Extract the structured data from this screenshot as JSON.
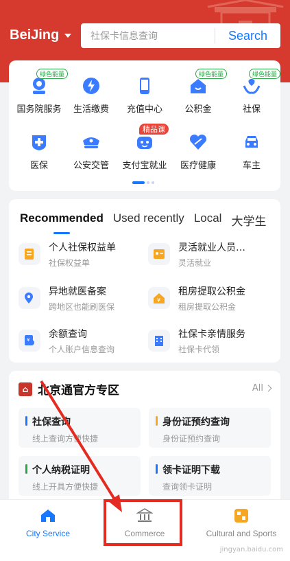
{
  "header": {
    "city": "BeiJing",
    "search_placeholder": "社保卡信息查询",
    "search_button": "Search"
  },
  "services": [
    {
      "label": "国务院服务",
      "icon": "gov-service-icon",
      "badge": "绿色能量",
      "badge_type": "green"
    },
    {
      "label": "生活缴费",
      "icon": "lightning-bill-icon",
      "badge": "",
      "badge_type": ""
    },
    {
      "label": "充值中心",
      "icon": "phone-recharge-icon",
      "badge": "",
      "badge_type": ""
    },
    {
      "label": "公积金",
      "icon": "housing-fund-icon",
      "badge": "绿色能量",
      "badge_type": "green"
    },
    {
      "label": "社保",
      "icon": "social-security-icon",
      "badge": "绿色能量",
      "badge_type": "green"
    },
    {
      "label": "医保",
      "icon": "medical-insurance-icon",
      "badge": "",
      "badge_type": ""
    },
    {
      "label": "公安交管",
      "icon": "police-cap-icon",
      "badge": "",
      "badge_type": ""
    },
    {
      "label": "支付宝就业",
      "icon": "employment-robot-icon",
      "badge": "精品课",
      "badge_type": "red"
    },
    {
      "label": "医疗健康",
      "icon": "health-heart-icon",
      "badge": "",
      "badge_type": ""
    },
    {
      "label": "车主",
      "icon": "car-icon",
      "badge": "",
      "badge_type": ""
    }
  ],
  "recommended": {
    "tabs": [
      "Recommended",
      "Used recently",
      "Local",
      "大学生"
    ],
    "active_tab": 0,
    "items": [
      {
        "title": "个人社保权益单",
        "sub": "社保权益单",
        "icon": "document-icon"
      },
      {
        "title": "灵活就业人员…",
        "sub": "灵活就业",
        "icon": "id-card-icon"
      },
      {
        "title": "异地就医备案",
        "sub": "跨地区也能刷医保",
        "icon": "location-plus-icon"
      },
      {
        "title": "租房提取公积金",
        "sub": "租房提取公积金",
        "icon": "house-yen-icon"
      },
      {
        "title": "余额查询",
        "sub": "个人账户信息查询",
        "icon": "balance-search-icon"
      },
      {
        "title": "社保卡亲情服务",
        "sub": "社保卡代领",
        "icon": "building-icon"
      }
    ]
  },
  "beijing": {
    "title": "北京通官方专区",
    "all_label": "All",
    "tiles": [
      {
        "title": "社保查询",
        "sub": "线上查询方便快捷",
        "color": "#1677ff"
      },
      {
        "title": "身份证预约查询",
        "sub": "身份证预约查询",
        "color": "#f5a623"
      },
      {
        "title": "个人纳税证明",
        "sub": "线上开具方便快捷",
        "color": "#27a844"
      },
      {
        "title": "领卡证明下载",
        "sub": "查询领卡证明",
        "color": "#1677ff"
      }
    ]
  },
  "nav": {
    "items": [
      {
        "label": "City Service",
        "icon": "home-icon",
        "active": true
      },
      {
        "label": "Commerce",
        "icon": "bank-icon",
        "active": false
      },
      {
        "label": "Cultural and Sports",
        "icon": "culture-sports-icon",
        "active": false
      }
    ]
  },
  "watermark": "jingyan.baidu.com",
  "colors": {
    "brand_red": "#d63a2f",
    "accent_blue": "#1677ff",
    "annotation_red": "#e42b22"
  }
}
